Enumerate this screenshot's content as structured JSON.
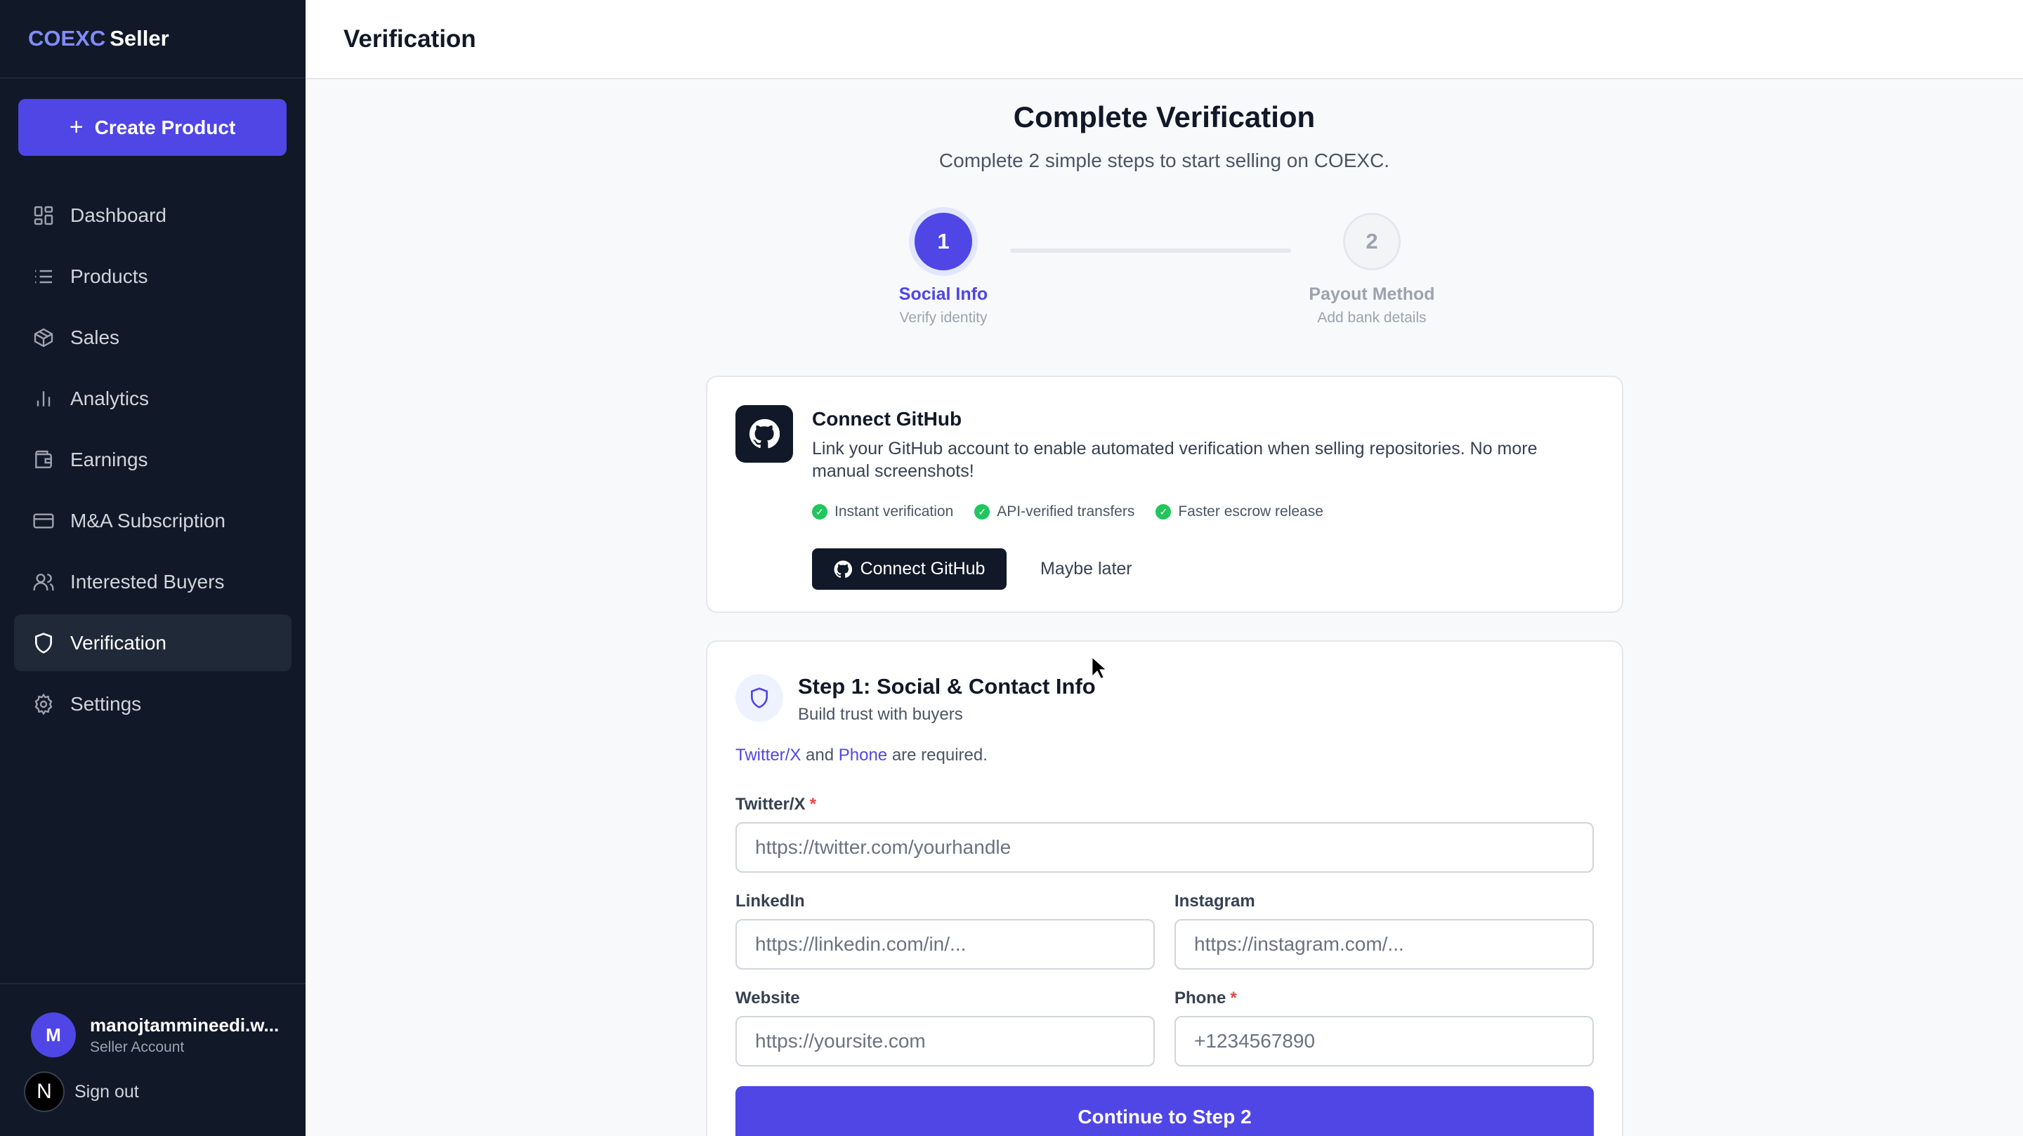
{
  "brand": {
    "part1": "COEXC",
    "part2": "Seller"
  },
  "sidebar": {
    "create_label": "Create Product",
    "items": [
      {
        "label": "Dashboard",
        "icon": "dashboard-icon"
      },
      {
        "label": "Products",
        "icon": "list-icon"
      },
      {
        "label": "Sales",
        "icon": "box-icon"
      },
      {
        "label": "Analytics",
        "icon": "bar-chart-icon"
      },
      {
        "label": "Earnings",
        "icon": "wallet-icon"
      },
      {
        "label": "M&A Subscription",
        "icon": "credit-card-icon"
      },
      {
        "label": "Interested Buyers",
        "icon": "users-icon"
      },
      {
        "label": "Verification",
        "icon": "shield-icon",
        "active": true
      },
      {
        "label": "Settings",
        "icon": "gear-icon"
      }
    ],
    "user": {
      "initial": "M",
      "name": "manojtammineedi.w...",
      "role": "Seller Account"
    },
    "signout": {
      "badge": "N",
      "label": "Sign out"
    }
  },
  "header": {
    "title": "Verification"
  },
  "main": {
    "title": "Complete Verification",
    "subtitle": "Complete 2 simple steps to start selling on COEXC.",
    "steps": [
      {
        "number": "1",
        "label": "Social Info",
        "sub": "Verify identity"
      },
      {
        "number": "2",
        "label": "Payout Method",
        "sub": "Add bank details"
      }
    ],
    "github": {
      "title": "Connect GitHub",
      "description": "Link your GitHub account to enable automated verification when selling repositories. No more manual screenshots!",
      "features": [
        "Instant verification",
        "API-verified transfers",
        "Faster escrow release"
      ],
      "connect_label": "Connect GitHub",
      "later_label": "Maybe later"
    },
    "form": {
      "title": "Step 1: Social & Contact Info",
      "description": "Build trust with buyers",
      "req": {
        "a": "Twitter/X",
        "and": "and",
        "b": "Phone",
        "tail": "are required."
      },
      "twitter": {
        "label": "Twitter/X",
        "placeholder": "https://twitter.com/yourhandle",
        "value": ""
      },
      "linkedin": {
        "label": "LinkedIn",
        "placeholder": "https://linkedin.com/in/...",
        "value": ""
      },
      "instagram": {
        "label": "Instagram",
        "placeholder": "https://instagram.com/...",
        "value": ""
      },
      "website": {
        "label": "Website",
        "placeholder": "https://yoursite.com",
        "value": ""
      },
      "phone": {
        "label": "Phone",
        "placeholder": "+1234567890",
        "value": ""
      },
      "required_mark": "*",
      "continue_label": "Continue to Step 2"
    }
  },
  "colors": {
    "accent": "#4f46e5",
    "sidebar_bg": "#111827",
    "success": "#22c55e",
    "required": "#ef4444"
  }
}
